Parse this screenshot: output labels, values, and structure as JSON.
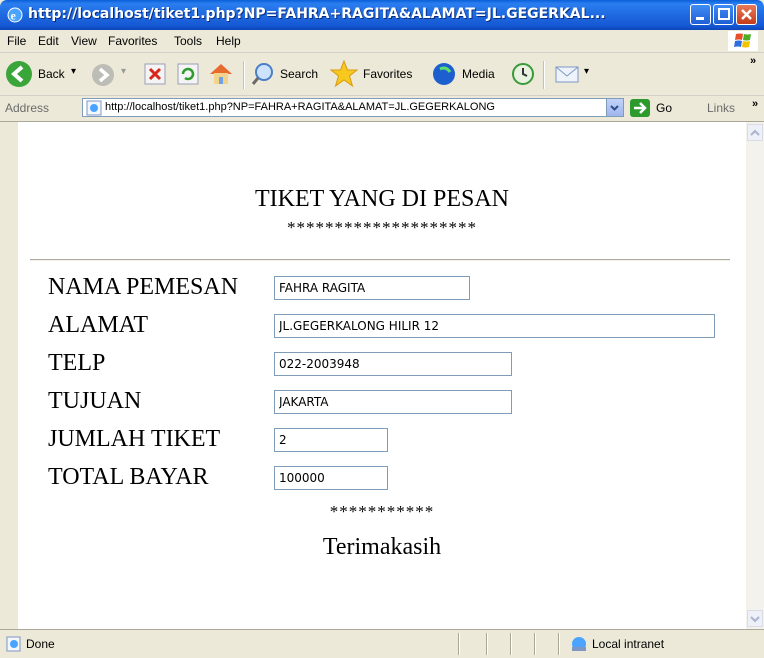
{
  "window": {
    "title": "http://localhost/tiket1.php?NP=FAHRA+RAGITA&ALAMAT=JL.GEGERKAL..."
  },
  "menu": {
    "items": [
      "File",
      "Edit",
      "View",
      "Favorites",
      "Tools",
      "Help"
    ]
  },
  "toolbar": {
    "back_label": "Back",
    "search_label": "Search",
    "favorites_label": "Favorites",
    "media_label": "Media"
  },
  "address": {
    "label": "Address",
    "url": "http://localhost/tiket1.php?NP=FAHRA+RAGITA&ALAMAT=JL.GEGERKALONG",
    "go_label": "Go",
    "links_label": "Links"
  },
  "page": {
    "title": "TIKET YANG DI PESAN",
    "stars_top": "********************",
    "fields": [
      {
        "label": "NAMA PEMESAN",
        "value": "FAHRA RAGITA"
      },
      {
        "label": "ALAMAT",
        "value": "JL.GEGERKALONG HILIR 12"
      },
      {
        "label": "TELP",
        "value": "022-2003948"
      },
      {
        "label": "TUJUAN",
        "value": "JAKARTA"
      },
      {
        "label": "JUMLAH TIKET",
        "value": "2"
      },
      {
        "label": "TOTAL BAYAR",
        "value": "100000"
      }
    ],
    "stars_bottom": "***********",
    "thanks": "Terimakasih"
  },
  "status": {
    "text": "Done",
    "zone": "Local intranet"
  },
  "colors": {
    "titlebar": "#1f69e0",
    "chrome": "#ece9d8",
    "input_border": "#7f9db9"
  }
}
